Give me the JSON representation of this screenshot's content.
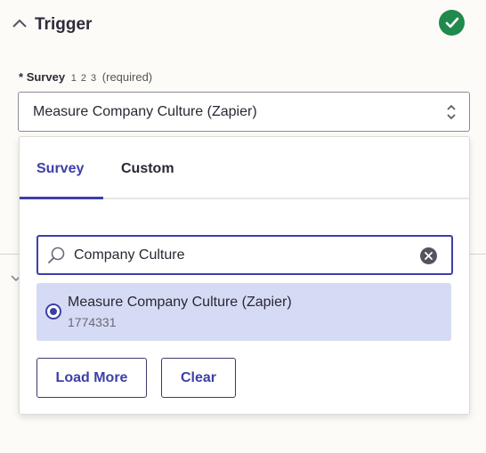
{
  "header": {
    "title": "Trigger",
    "status_icon": "check-circle-icon",
    "status_color": "#1f8a4c"
  },
  "field": {
    "required_marker": "*",
    "name": "Survey",
    "type_hint": "1 2 3",
    "required_text": "(required)",
    "selected_value": "Measure Company Culture (Zapier)"
  },
  "dropdown": {
    "tabs": [
      {
        "label": "Survey",
        "active": true
      },
      {
        "label": "Custom",
        "active": false
      }
    ],
    "search": {
      "value": "Company Culture"
    },
    "results": [
      {
        "title": "Measure Company Culture (Zapier)",
        "id": "1774331",
        "selected": true
      }
    ],
    "buttons": {
      "load_more": "Load More",
      "clear": "Clear"
    }
  },
  "colors": {
    "accent": "#3d3fa8",
    "selected_bg": "#d5dbf4"
  }
}
